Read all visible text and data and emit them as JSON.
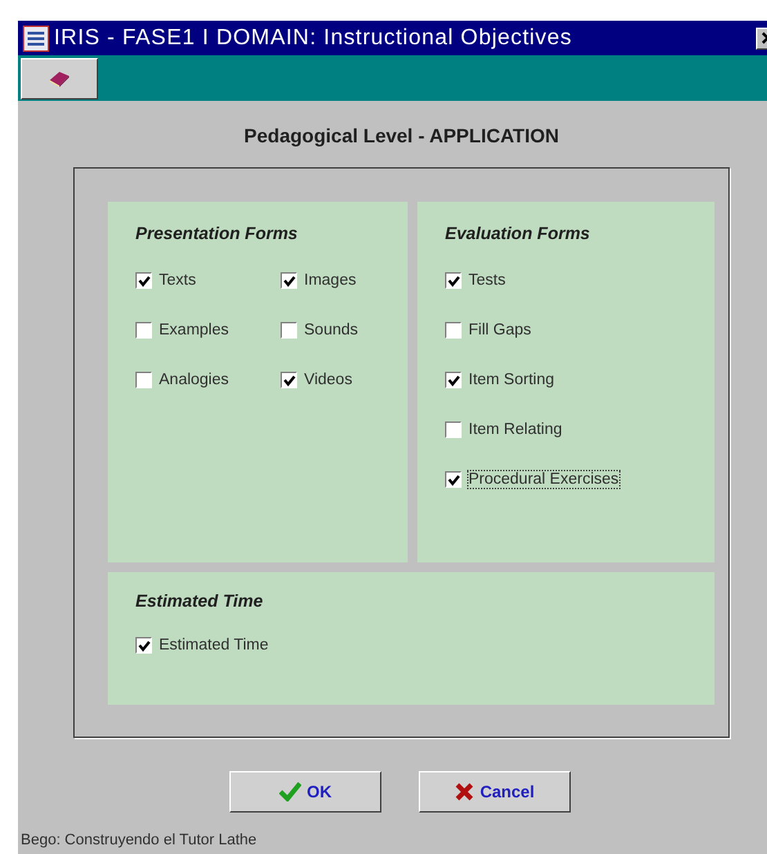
{
  "window": {
    "title": "IRIS - FASE1 I DOMAIN: Instructional Objectives"
  },
  "heading": "Pedagogical Level - APPLICATION",
  "presentation": {
    "title": "Presentation Forms",
    "items": [
      {
        "label": "Texts",
        "checked": true
      },
      {
        "label": "Images",
        "checked": true
      },
      {
        "label": "Examples",
        "checked": false
      },
      {
        "label": "Sounds",
        "checked": false
      },
      {
        "label": "Analogies",
        "checked": false
      },
      {
        "label": "Videos",
        "checked": true
      }
    ]
  },
  "evaluation": {
    "title": "Evaluation Forms",
    "items": [
      {
        "label": "Tests",
        "checked": true,
        "focused": false
      },
      {
        "label": "Fill Gaps",
        "checked": false,
        "focused": false
      },
      {
        "label": "Item Sorting",
        "checked": true,
        "focused": false
      },
      {
        "label": "Item Relating",
        "checked": false,
        "focused": false
      },
      {
        "label": "Procedural Exercises",
        "checked": true,
        "focused": true
      }
    ]
  },
  "time": {
    "title": "Estimated Time",
    "items": [
      {
        "label": "Estimated Time",
        "checked": true
      }
    ]
  },
  "buttons": [
    {
      "label": "OK",
      "kind": "ok"
    },
    {
      "label": "Cancel",
      "kind": "cancel"
    }
  ],
  "status_bar": "Bego: Construyendo el Tutor Lathe"
}
